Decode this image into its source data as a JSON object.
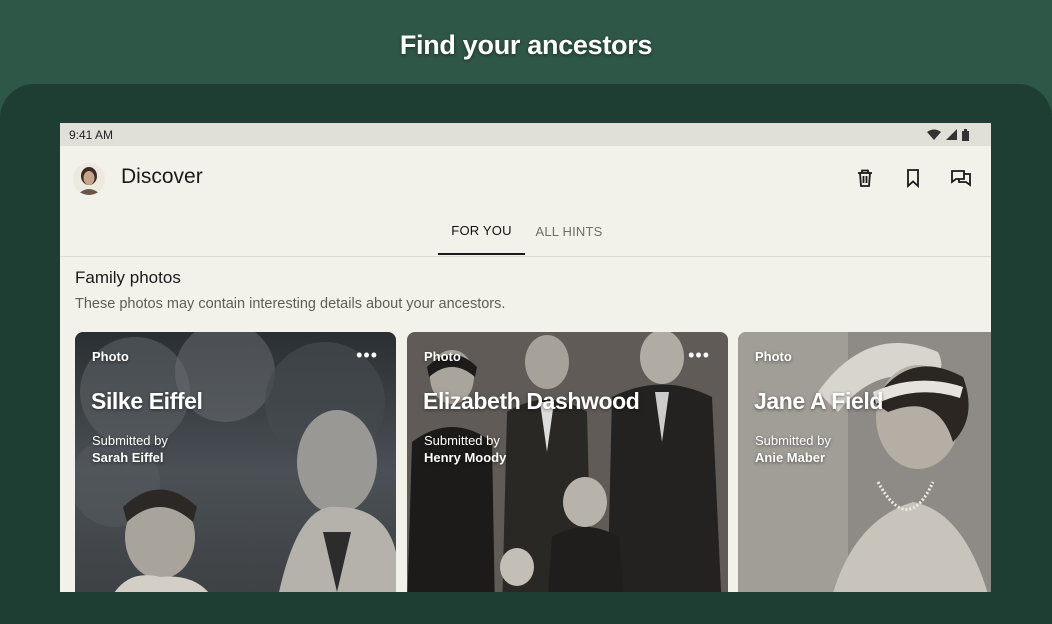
{
  "promo": {
    "title": "Find your ancestors"
  },
  "status_bar": {
    "time": "9:41 AM"
  },
  "app_bar": {
    "title": "Discover"
  },
  "tabs": [
    {
      "label": "FOR YOU",
      "active": true
    },
    {
      "label": "ALL HINTS",
      "active": false
    }
  ],
  "section": {
    "title": "Family photos",
    "subtitle": "These photos may contain interesting details about your ancestors."
  },
  "cards": [
    {
      "type": "Photo",
      "name": "Silke Eiffel",
      "submitted_label": "Submitted by",
      "submitter": "Sarah Eiffel",
      "more": "•••"
    },
    {
      "type": "Photo",
      "name": "Elizabeth Dashwood",
      "submitted_label": "Submitted by",
      "submitter": "Henry Moody",
      "more": "•••"
    },
    {
      "type": "Photo",
      "name": "Jane A Field",
      "submitted_label": "Submitted by",
      "submitter": "Anie Maber"
    }
  ],
  "colors": {
    "background": "#2f5747",
    "device": "#1f3e33",
    "screen": "#f3f2ea"
  }
}
